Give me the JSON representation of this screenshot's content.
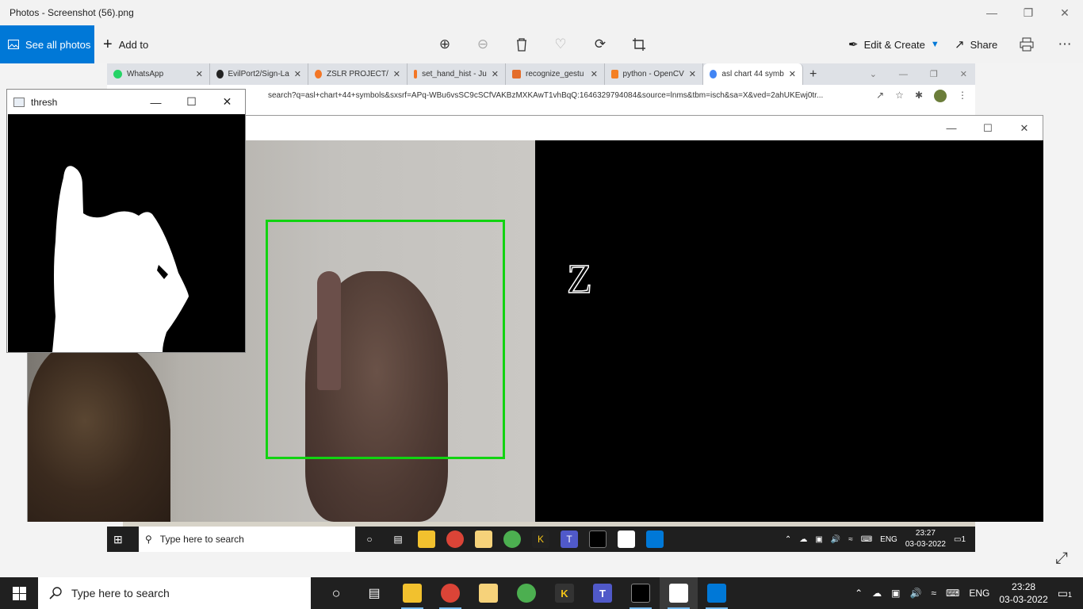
{
  "window": {
    "title": "Photos - Screenshot (56).png"
  },
  "toolbar": {
    "see_all_label": "See all photos",
    "add_to_label": "Add to",
    "edit_create_label": "Edit & Create",
    "share_label": "Share"
  },
  "browser": {
    "tabs": [
      {
        "label": "WhatsApp",
        "color": "#25d366"
      },
      {
        "label": "EvilPort2/Sign-La",
        "color": "#222222"
      },
      {
        "label": "ZSLR PROJECT/",
        "color": "#f37626"
      },
      {
        "label": "set_hand_hist - Ju",
        "color": "#f37626"
      },
      {
        "label": "recognize_gestu",
        "color": "#e46d2b"
      },
      {
        "label": "python - OpenCV",
        "color": "#f48024"
      },
      {
        "label": "asl chart 44 symb",
        "color": "#4285f4"
      }
    ],
    "url": "search?q=asl+chart+44+symbols&sxsrf=APq-WBu6vsSC9cSCfVAKBzMXKAwT1vhBqQ:1646329794084&source=lnms&tbm=isch&sa=X&ved=2ahUKEwj0tr..."
  },
  "thresh_window": {
    "title": "thresh"
  },
  "recognition": {
    "letter": "Z"
  },
  "inner_taskbar": {
    "search_placeholder": "Type here to search",
    "lang": "ENG",
    "time": "23:27",
    "date": "03-03-2022",
    "notif_count": "1"
  },
  "taskbar": {
    "search_placeholder": "Type here to search",
    "lang": "ENG",
    "time": "23:28",
    "date": "03-03-2022",
    "notif_count": "1"
  },
  "colors": {
    "accent": "#0078d7",
    "roi_box": "#11d311"
  }
}
